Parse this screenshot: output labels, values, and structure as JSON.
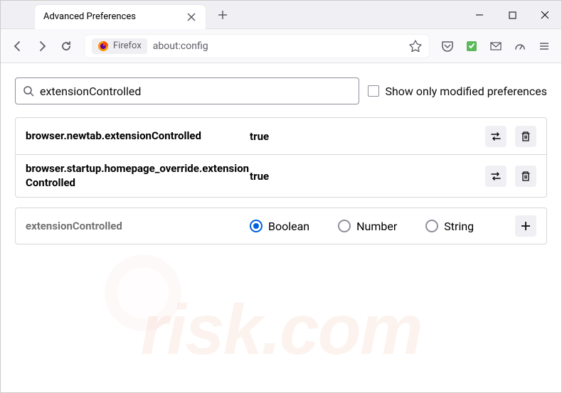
{
  "tab": {
    "title": "Advanced Preferences"
  },
  "urlbar": {
    "brand": "Firefox",
    "url": "about:config"
  },
  "search": {
    "value": "extensionControlled",
    "modifiedLabel": "Show only modified preferences"
  },
  "prefs": [
    {
      "name": "browser.newtab.extensionControlled",
      "value": "true"
    },
    {
      "name": "browser.startup.homepage_override.extensionControlled",
      "value": "true"
    }
  ],
  "newPref": {
    "name": "extensionControlled",
    "types": [
      "Boolean",
      "Number",
      "String"
    ]
  }
}
